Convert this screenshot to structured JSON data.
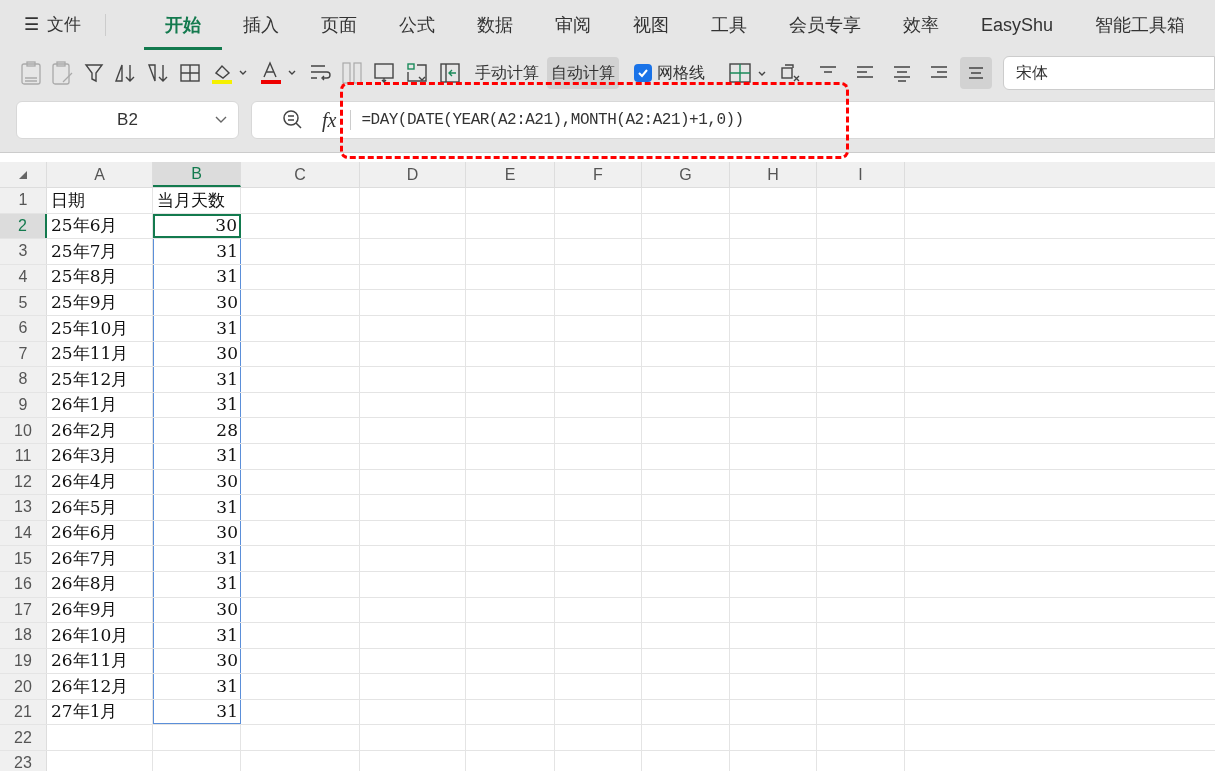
{
  "menu": {
    "icon": "☰",
    "file_label": "文件"
  },
  "tabs": [
    {
      "label": "开始",
      "selected": true
    },
    {
      "label": "插入",
      "selected": false
    },
    {
      "label": "页面",
      "selected": false
    },
    {
      "label": "公式",
      "selected": false
    },
    {
      "label": "数据",
      "selected": false
    },
    {
      "label": "审阅",
      "selected": false
    },
    {
      "label": "视图",
      "selected": false
    },
    {
      "label": "工具",
      "selected": false
    },
    {
      "label": "会员专享",
      "selected": false
    },
    {
      "label": "效率",
      "selected": false
    },
    {
      "label": "EasyShu",
      "selected": false
    },
    {
      "label": "智能工具箱",
      "selected": false
    }
  ],
  "toolbar": {
    "calc_buttons": [
      {
        "label": "手动计算",
        "selected": false
      },
      {
        "label": "自动计算",
        "selected": true
      }
    ],
    "gridlines": {
      "label": "网格线",
      "checked": true
    },
    "font_field": {
      "value": "宋体"
    }
  },
  "formula_bar": {
    "name_box": "B2",
    "fx": "fx",
    "formula": "=DAY(DATE(YEAR(A2:A21),MONTH(A2:A21)+1,0))"
  },
  "sheet": {
    "columns": [
      {
        "label": "A",
        "selected": false
      },
      {
        "label": "B",
        "selected": true
      },
      {
        "label": "C",
        "selected": false
      },
      {
        "label": "D",
        "selected": false
      },
      {
        "label": "E",
        "selected": false
      },
      {
        "label": "F",
        "selected": false
      },
      {
        "label": "G",
        "selected": false
      },
      {
        "label": "H",
        "selected": false
      },
      {
        "label": "I",
        "selected": false
      }
    ],
    "rows": [
      {
        "number": "1",
        "a": "日期",
        "b": "当月天数",
        "selected": false
      },
      {
        "number": "2",
        "a": "25年6月",
        "b": "30",
        "selected": true
      },
      {
        "number": "3",
        "a": "25年7月",
        "b": "31",
        "selected": false
      },
      {
        "number": "4",
        "a": "25年8月",
        "b": "31",
        "selected": false
      },
      {
        "number": "5",
        "a": "25年9月",
        "b": "30",
        "selected": false
      },
      {
        "number": "6",
        "a": "25年10月",
        "b": "31",
        "selected": false
      },
      {
        "number": "7",
        "a": "25年11月",
        "b": "30",
        "selected": false
      },
      {
        "number": "8",
        "a": "25年12月",
        "b": "31",
        "selected": false
      },
      {
        "number": "9",
        "a": "26年1月",
        "b": "31",
        "selected": false
      },
      {
        "number": "10",
        "a": "26年2月",
        "b": "28",
        "selected": false
      },
      {
        "number": "11",
        "a": "26年3月",
        "b": "31",
        "selected": false
      },
      {
        "number": "12",
        "a": "26年4月",
        "b": "30",
        "selected": false
      },
      {
        "number": "13",
        "a": "26年5月",
        "b": "31",
        "selected": false
      },
      {
        "number": "14",
        "a": "26年6月",
        "b": "30",
        "selected": false
      },
      {
        "number": "15",
        "a": "26年7月",
        "b": "31",
        "selected": false
      },
      {
        "number": "16",
        "a": "26年8月",
        "b": "31",
        "selected": false
      },
      {
        "number": "17",
        "a": "26年9月",
        "b": "30",
        "selected": false
      },
      {
        "number": "18",
        "a": "26年10月",
        "b": "31",
        "selected": false
      },
      {
        "number": "19",
        "a": "26年11月",
        "b": "30",
        "selected": false
      },
      {
        "number": "20",
        "a": "26年12月",
        "b": "31",
        "selected": false
      },
      {
        "number": "21",
        "a": "27年1月",
        "b": "31",
        "selected": false
      },
      {
        "number": "22",
        "a": "",
        "b": "",
        "selected": false
      },
      {
        "number": "23",
        "a": "",
        "b": "",
        "selected": false
      }
    ]
  }
}
